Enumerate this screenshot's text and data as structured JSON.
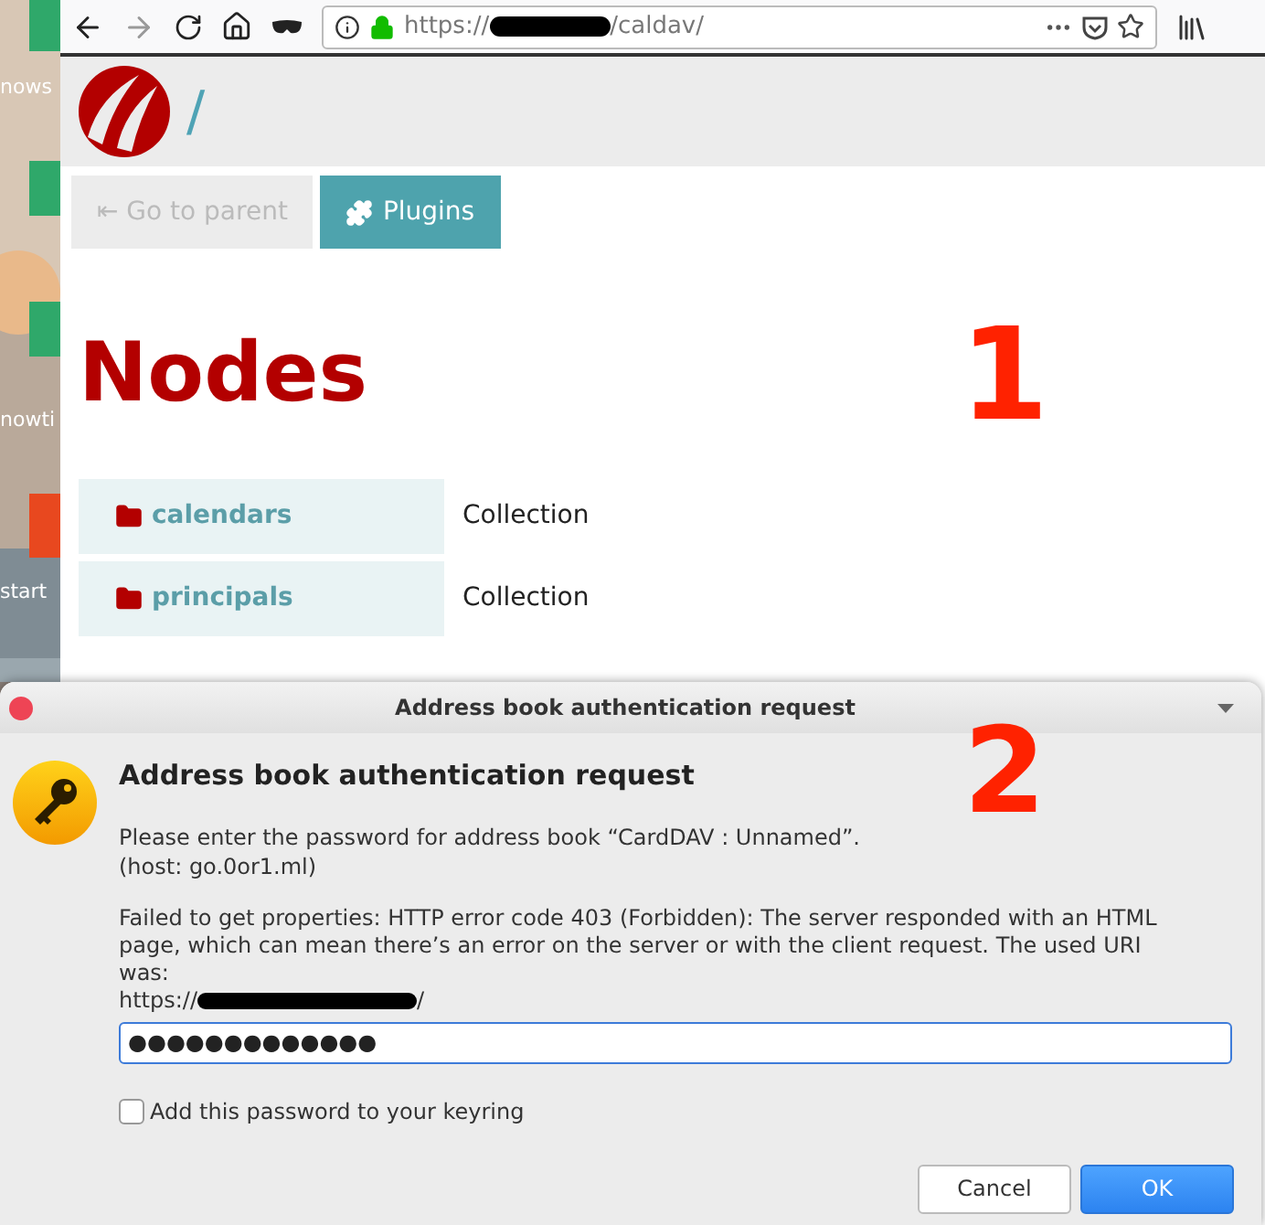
{
  "desktop": {
    "icon_labels": [
      "nows",
      "nowti",
      "start"
    ]
  },
  "browser": {
    "url_prefix": "https://",
    "url_suffix": "/caldav/"
  },
  "page": {
    "breadcrumb": "/",
    "buttons": [
      {
        "label": "⇤ Go to parent",
        "disabled": true
      },
      {
        "label": "Plugins",
        "disabled": false
      }
    ],
    "heading": "Nodes",
    "rows": [
      {
        "name": "calendars",
        "type": "Collection"
      },
      {
        "name": "principals",
        "type": "Collection"
      }
    ]
  },
  "annotations": [
    "1",
    "2"
  ],
  "dialog": {
    "title": "Address book authentication request",
    "heading": "Address book authentication request",
    "message": "Please enter the password for address book “CardDAV : Unnamed”.",
    "host": "(host: go.0or1.ml)",
    "error": "Failed to get properties: HTTP error code 403 (Forbidden): The server responded with an HTML page, which can mean there’s an error on the server or with the client request. The used URI was:",
    "uri_prefix": "https://",
    "uri_suffix": "/",
    "password": "●●●●●●●●●●●●●",
    "keyring": {
      "label": "Add this password to your keyring",
      "checked": false
    },
    "buttons": [
      {
        "label": "Cancel",
        "default": false
      },
      {
        "label": "OK",
        "default": true
      }
    ]
  }
}
